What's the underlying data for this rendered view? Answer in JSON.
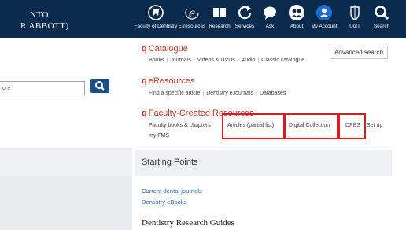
{
  "header": {
    "title_line1": "NTO",
    "title_line2": "R ABBOTT)",
    "nav": [
      {
        "label": "Faculty of Dentistry",
        "icon": "tooth-crest-icon"
      },
      {
        "label": "E-resources",
        "icon": "e-resources-icon"
      },
      {
        "label": "Research",
        "icon": "book-icon"
      },
      {
        "label": "Services",
        "icon": "refresh-icon"
      },
      {
        "label": "Ask",
        "icon": "chat-bubble-icon"
      },
      {
        "label": "About",
        "icon": "people-icon"
      },
      {
        "label": "My Account",
        "icon": "user-icon"
      },
      {
        "label": "UofT",
        "icon": "crest-icon"
      },
      {
        "label": "Search",
        "icon": "search-icon"
      }
    ]
  },
  "search": {
    "placeholder": "ore"
  },
  "catalogue": {
    "heading": "Catalogue",
    "links": [
      "Books",
      "Journals",
      "Videos & DVDs",
      "Audio",
      "Classic catalogue"
    ],
    "advanced": "Advanced search"
  },
  "eresources": {
    "heading": "eResources",
    "links": [
      "Find a specific article",
      "Dentistry eJournals",
      "Databases"
    ]
  },
  "faculty": {
    "heading": "Faculty-Created Resources",
    "links": [
      "Faculty books & chapters",
      "Articles (partial list)",
      "Digital Collection",
      "DPES",
      "Set up"
    ],
    "line2": "my FMS"
  },
  "starting": {
    "title": "Starting Points",
    "links": [
      "Current dental journals",
      "Dentistry eBooks"
    ],
    "guides": "Dentistry Research Guides"
  },
  "colors": {
    "header_bg": "#0a2a4e",
    "accent_red": "#c0392b",
    "link_blue": "#2a6fb7",
    "highlight": "#e0191f"
  }
}
